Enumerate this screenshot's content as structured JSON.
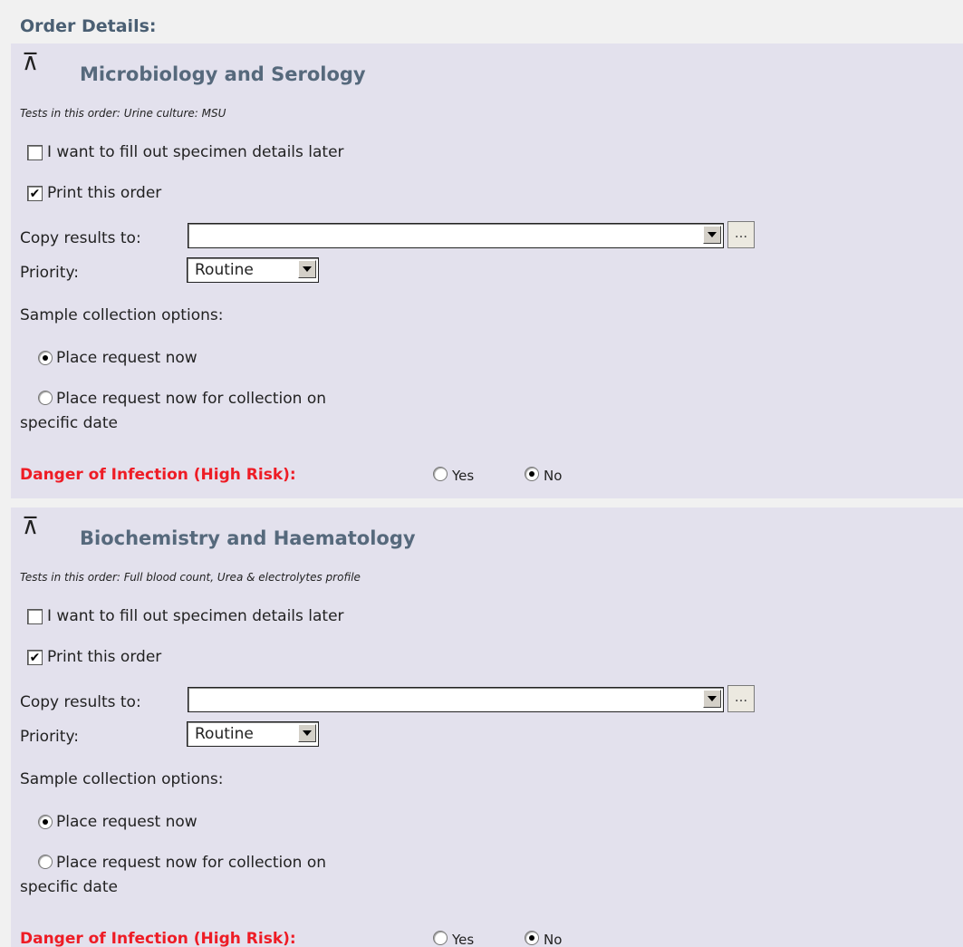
{
  "header": {
    "title": "Order Details:"
  },
  "sections": [
    {
      "title": "Microbiology and Serology",
      "tests": "Tests in this order: Urine culture: MSU",
      "fill_later_label": "I want to fill out specimen details later",
      "fill_later_checked": false,
      "print_label": "Print this order",
      "print_checked": true,
      "copy_results_label": "Copy results to:",
      "copy_results_value": "",
      "ellipsis_label": "...",
      "priority_label": "Priority:",
      "priority_value": "Routine",
      "sample_label": "Sample collection options:",
      "option_now": "Place request now",
      "option_specific_line1": "Place request now for collection on",
      "option_specific_line2": "specific date",
      "selected_option": "now",
      "danger_label": "Danger of Infection (High Risk):",
      "yes_label": "Yes",
      "no_label": "No",
      "danger_value": "No"
    },
    {
      "title": "Biochemistry and Haematology",
      "tests": "Tests in this order: Full blood count, Urea & electrolytes profile",
      "fill_later_label": "I want to fill out specimen details later",
      "fill_later_checked": false,
      "print_label": "Print this order",
      "print_checked": true,
      "copy_results_label": "Copy results to:",
      "copy_results_value": "",
      "ellipsis_label": "...",
      "priority_label": "Priority:",
      "priority_value": "Routine",
      "sample_label": "Sample collection options:",
      "option_now": "Place request now",
      "option_specific_line1": "Place request now for collection on",
      "option_specific_line2": "specific date",
      "selected_option": "now",
      "danger_label": "Danger of Infection (High Risk):",
      "yes_label": "Yes",
      "no_label": "No",
      "danger_value": "No"
    }
  ],
  "colors": {
    "danger": "#ee1c25",
    "section_bg": "#e3e1ed",
    "title": "#56697c"
  }
}
